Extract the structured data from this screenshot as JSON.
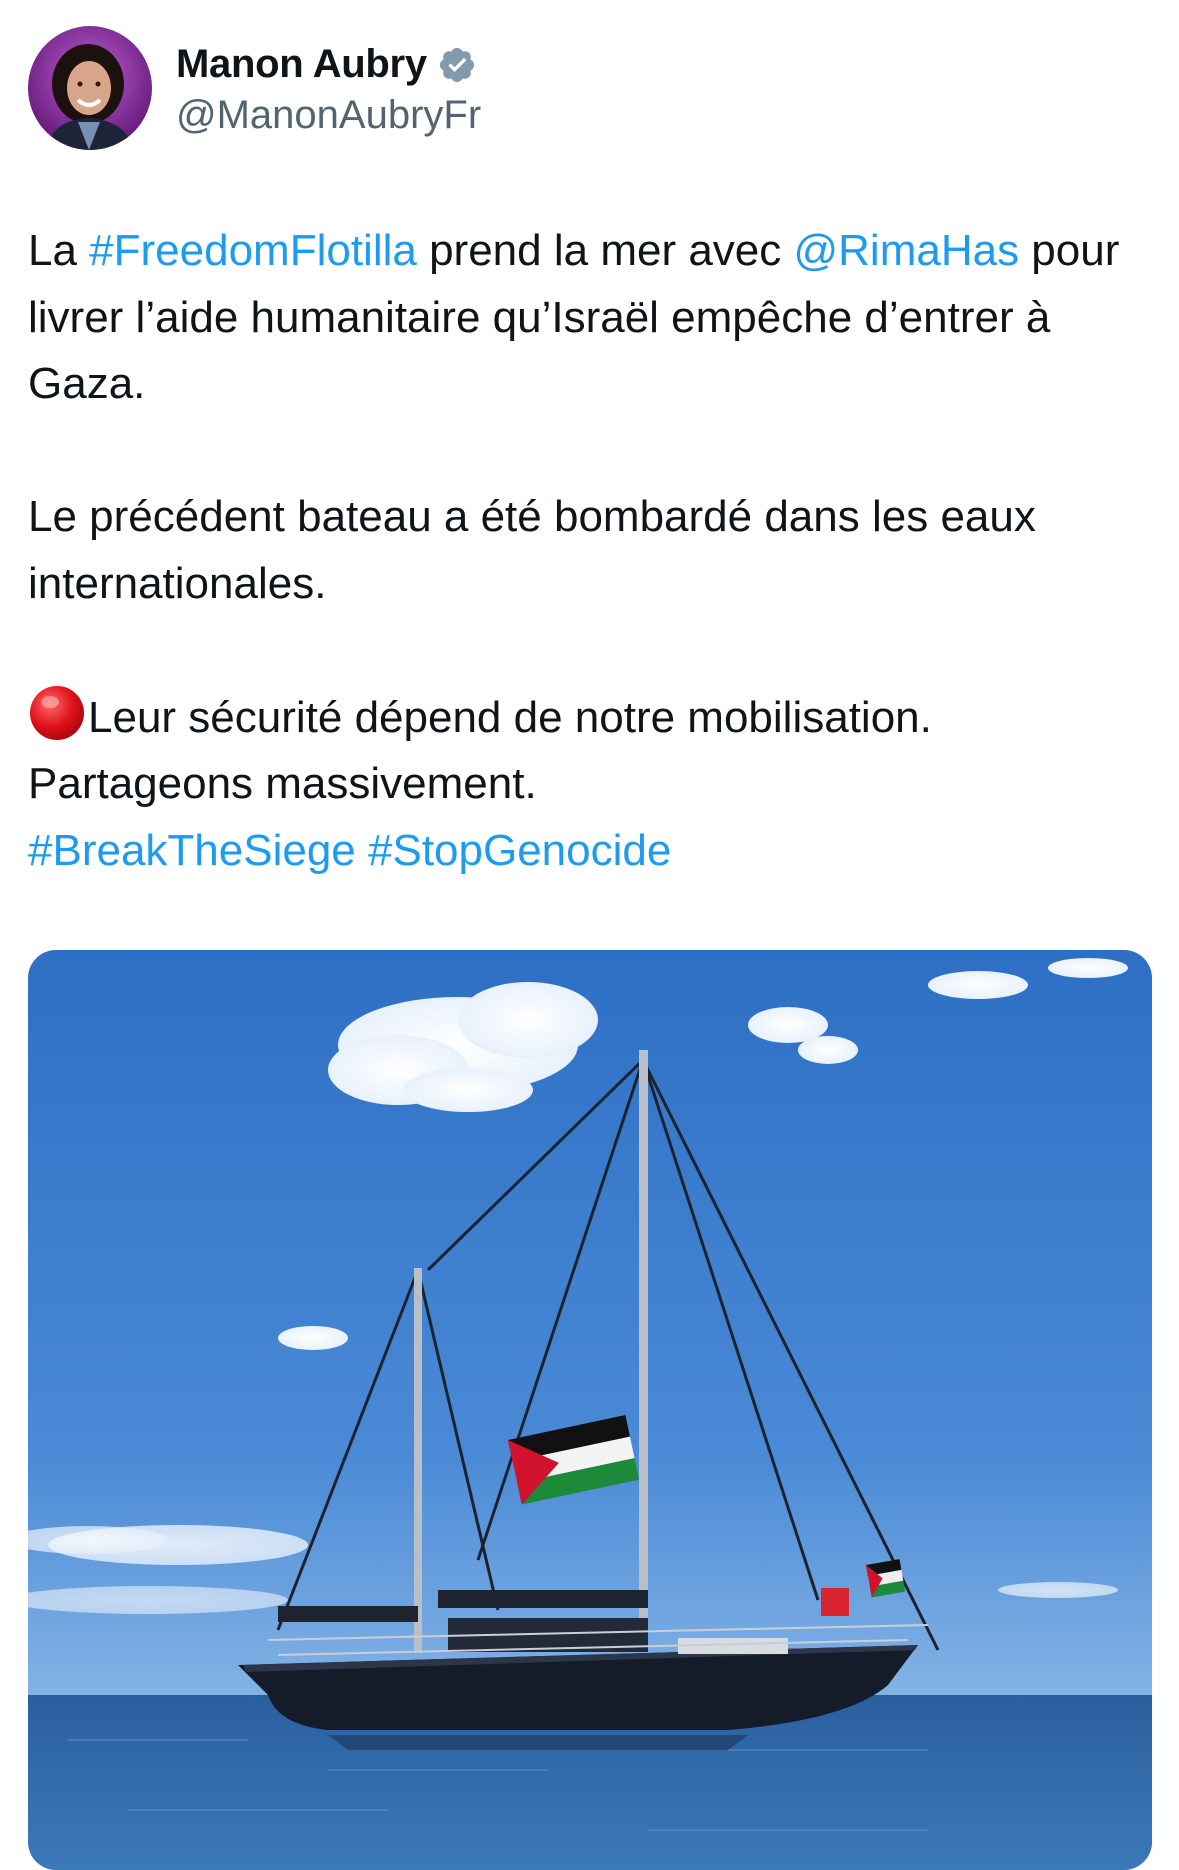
{
  "author": {
    "display_name": "Manon Aubry",
    "handle": "@ManonAubryFr",
    "avatar_icon": "profile-photo",
    "verified_icon": "verified-badge-icon"
  },
  "tweet": {
    "p1": {
      "t1": "La ",
      "hashtag1": "#FreedomFlotilla",
      "t2": " prend la mer avec ",
      "mention": "@RimaHas",
      "t3": " pour livrer l’aide humanitaire qu’Israël empêche d’entrer à Gaza."
    },
    "p2": "Le précédent bateau a été bombardé dans les eaux internationales.",
    "p3": {
      "emoji_icon": "red-circle-emoji",
      "text": "Leur sécurité dépend de notre mobilisation.",
      "line2": "Partageons massivement.",
      "hashtag2": "#BreakTheSiege",
      "hashtag3": "#StopGenocide"
    }
  },
  "media": {
    "description_icon": "sailboat-photo"
  },
  "colors": {
    "link": "#1d9bf0",
    "text": "#0f1419",
    "secondary": "#536471",
    "verified": "#829aab"
  }
}
